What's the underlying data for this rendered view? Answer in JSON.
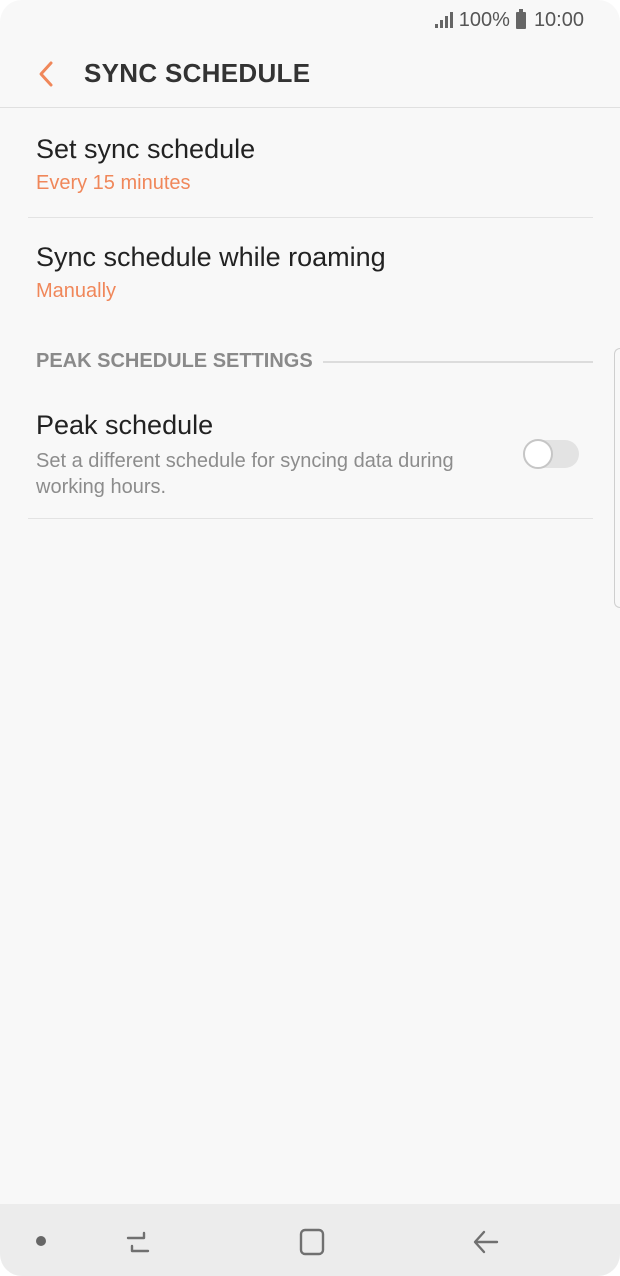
{
  "status_bar": {
    "battery": "100%",
    "time": "10:00",
    "icons": [
      "signal-icon",
      "battery-icon"
    ]
  },
  "header": {
    "title": "SYNC SCHEDULE",
    "back_icon": "chevron-left-icon",
    "accent_color": "#f0875a"
  },
  "settings": {
    "set_sync": {
      "title": "Set sync schedule",
      "value": "Every 15 minutes"
    },
    "roaming": {
      "title": "Sync schedule while roaming",
      "value": "Manually"
    },
    "peak_section": {
      "label": "PEAK SCHEDULE SETTINGS"
    },
    "peak": {
      "title": "Peak schedule",
      "description": "Set a different schedule for syncing data during working hours.",
      "enabled": false
    }
  },
  "nav_bar": {
    "icons": [
      "recent-apps-icon",
      "home-icon",
      "back-icon"
    ]
  }
}
